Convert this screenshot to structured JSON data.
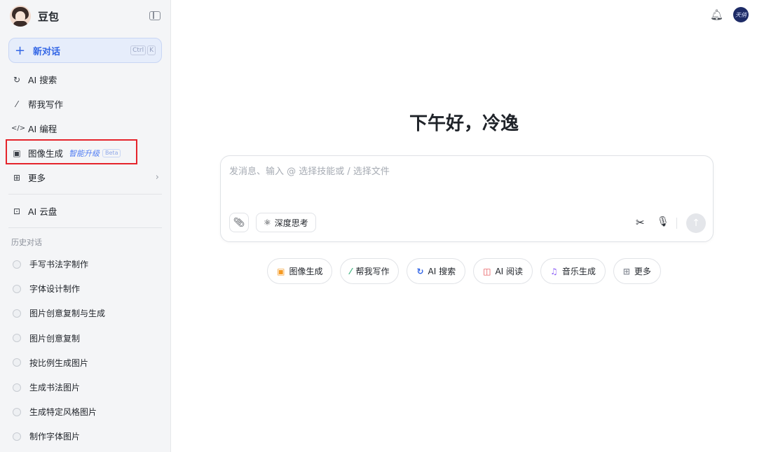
{
  "brand": {
    "name": "豆包"
  },
  "new_chat": {
    "label": "新对话",
    "shortcut": [
      "Ctrl",
      "K"
    ]
  },
  "nav": [
    {
      "icon": "ai-search-icon",
      "glyph": "C̣",
      "label": "AI 搜索"
    },
    {
      "icon": "writing-icon",
      "glyph": "⁄",
      "label": "帮我写作"
    },
    {
      "icon": "code-icon",
      "glyph": "</>",
      "label": "AI 编程"
    },
    {
      "icon": "image-generation-icon",
      "glyph": "▣",
      "label": "图像生成",
      "badge": "智能升级",
      "beta": "Beta"
    },
    {
      "icon": "more-grid-icon",
      "glyph": "⊞",
      "label": "更多"
    }
  ],
  "cloud": {
    "icon": "cloud-drive-icon",
    "label": "AI 云盘"
  },
  "history": {
    "title": "历史对话",
    "items": [
      "手写书法字制作",
      "字体设计制作",
      "图片创意复制与生成",
      "图片创意复制",
      "按比例生成图片",
      "生成书法图片",
      "生成特定风格图片",
      "制作字体图片"
    ]
  },
  "user": {
    "avatar_text": "天俏"
  },
  "greeting": "下午好，冷逸",
  "composer": {
    "placeholder": "发消息、输入 @ 选择技能或 / 选择文件",
    "deep_think_label": "深度思考"
  },
  "chips": [
    {
      "icon": "image-generation-icon",
      "label": "图像生成",
      "color": "#f59a23"
    },
    {
      "icon": "writing-icon",
      "label": "帮我写作",
      "color": "#3fb27f"
    },
    {
      "icon": "ai-search-icon",
      "label": "AI 搜索",
      "color": "#3366e6"
    },
    {
      "icon": "ai-reading-icon",
      "label": "AI 阅读",
      "color": "#e5484d"
    },
    {
      "icon": "music-icon",
      "label": "音乐生成",
      "color": "#8b5cf6"
    },
    {
      "icon": "more-grid-icon",
      "label": "更多",
      "color": "#8a8f99"
    }
  ]
}
